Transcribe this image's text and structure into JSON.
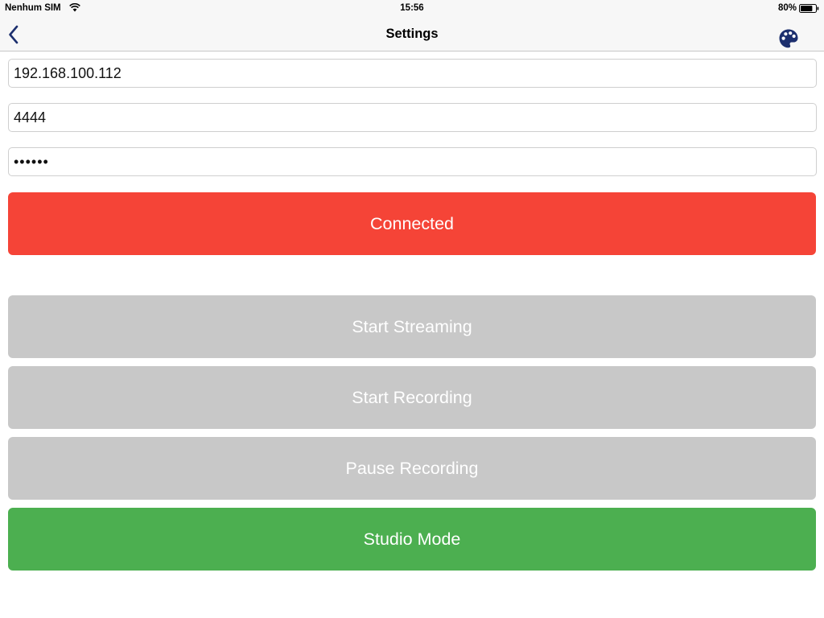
{
  "status_bar": {
    "carrier": "Nenhum SIM",
    "time": "15:56",
    "battery_percent": "80%",
    "battery_level": 0.8,
    "icons": [
      "wifi-icon",
      "battery-icon"
    ]
  },
  "nav": {
    "title": "Settings",
    "back_icon": "chevron-left-icon",
    "right_icon": "palette-icon",
    "accent_color": "#1c2f6e"
  },
  "form": {
    "host": "192.168.100.112",
    "port": "4444",
    "password": "••••••"
  },
  "buttons": {
    "connection": {
      "label": "Connected",
      "color": "#f54437"
    },
    "start_streaming": {
      "label": "Start Streaming",
      "color": "#c8c8c8"
    },
    "start_recording": {
      "label": "Start Recording",
      "color": "#c8c8c8"
    },
    "pause_recording": {
      "label": "Pause Recording",
      "color": "#c8c8c8"
    },
    "studio_mode": {
      "label": "Studio Mode",
      "color": "#4caf50"
    }
  }
}
